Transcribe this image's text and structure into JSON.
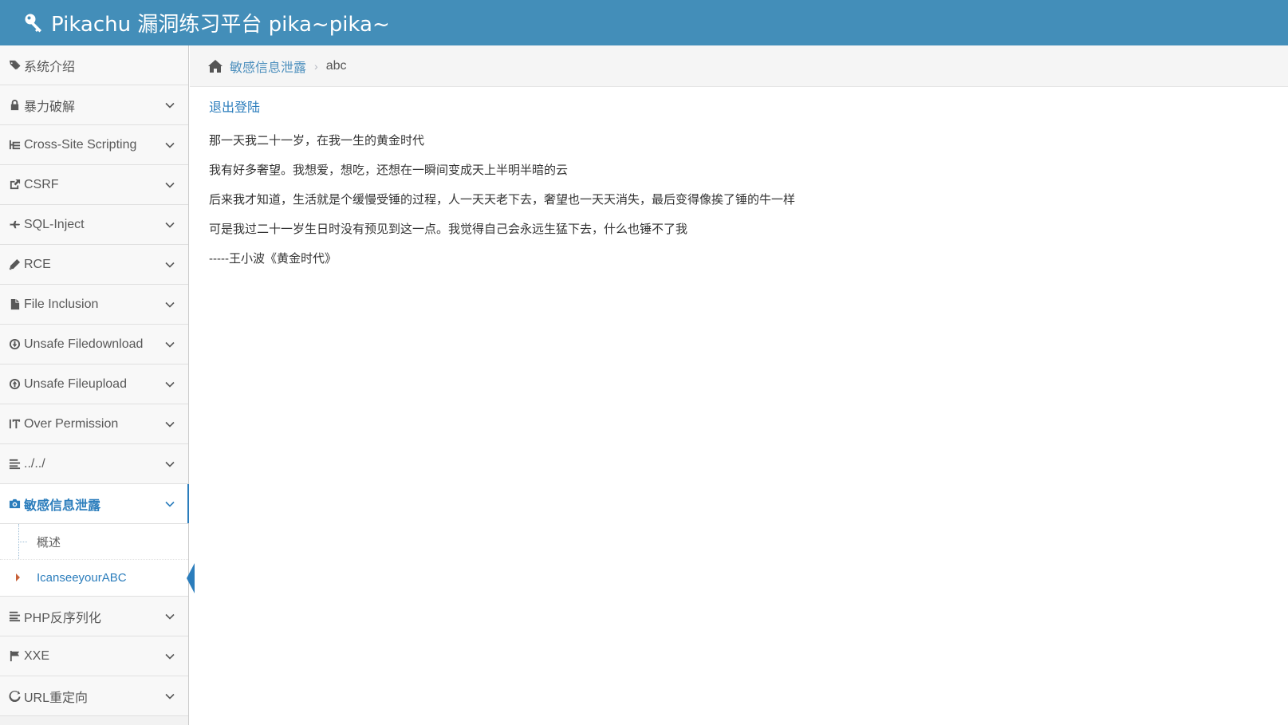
{
  "header": {
    "title": "Pikachu 漏洞练习平台 pika~pika~",
    "brand_icon": "key-icon",
    "color": "#438eb9"
  },
  "sidebar": {
    "items": [
      {
        "label": "系统介绍",
        "icon": "tags-icon",
        "expandable": false
      },
      {
        "label": "暴力破解",
        "icon": "lock-icon",
        "expandable": true
      },
      {
        "label": "Cross-Site Scripting",
        "icon": "sitemap-icon",
        "expandable": true
      },
      {
        "label": "CSRF",
        "icon": "share-icon",
        "expandable": true
      },
      {
        "label": "SQL-Inject",
        "icon": "fighter-jet-icon",
        "expandable": true
      },
      {
        "label": "RCE",
        "icon": "pencil-icon",
        "expandable": true
      },
      {
        "label": "File Inclusion",
        "icon": "file-icon",
        "expandable": true
      },
      {
        "label": "Unsafe Filedownload",
        "icon": "download-icon",
        "expandable": true
      },
      {
        "label": "Unsafe Fileupload",
        "icon": "upload-icon",
        "expandable": true
      },
      {
        "label": "Over Permission",
        "icon": "text-height-icon",
        "expandable": true
      },
      {
        "label": "../../",
        "icon": "align-left-icon",
        "expandable": true
      },
      {
        "label": "敏感信息泄露",
        "icon": "camera-icon",
        "expandable": true,
        "active": true
      },
      {
        "label": "PHP反序列化",
        "icon": "align-left-icon",
        "expandable": true
      },
      {
        "label": "XXE",
        "icon": "flag-icon",
        "expandable": true
      },
      {
        "label": "URL重定向",
        "icon": "refresh-icon",
        "expandable": true
      }
    ],
    "submenu": [
      {
        "label": "概述"
      },
      {
        "label": "IcanseeyourABC",
        "active": true
      }
    ],
    "active_color": "#2b7dbc"
  },
  "breadcrumb": {
    "home_icon": "home-icon",
    "link": "敏感信息泄露",
    "current": "abc"
  },
  "content": {
    "logout": "退出登陆",
    "lines": [
      "那一天我二十一岁，在我一生的黄金时代",
      "我有好多奢望。我想爱，想吃，还想在一瞬间变成天上半明半暗的云",
      "后来我才知道，生活就是个缓慢受锤的过程，人一天天老下去，奢望也一天天消失，最后变得像挨了锤的牛一样",
      "可是我过二十一岁生日时没有预见到这一点。我觉得自己会永远生猛下去，什么也锤不了我",
      "-----王小波《黄金时代》"
    ]
  }
}
